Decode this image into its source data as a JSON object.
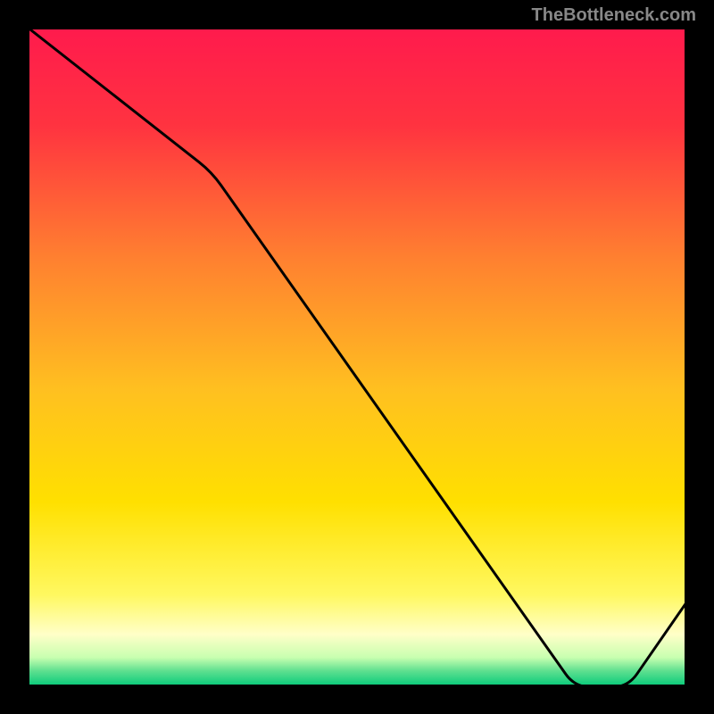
{
  "watermark": "TheBottleneck.com",
  "chart_data": {
    "type": "line",
    "title": "",
    "xlabel": "",
    "ylabel": "",
    "xlim": [
      0,
      100
    ],
    "ylim": [
      0,
      100
    ],
    "x": [
      0,
      28,
      83,
      91,
      100
    ],
    "y": [
      100,
      78,
      0,
      0,
      13
    ],
    "min_label_text": "",
    "background_gradient": {
      "type": "vertical",
      "stops": [
        {
          "offset": 0.0,
          "color": "#ff1a4d"
        },
        {
          "offset": 0.15,
          "color": "#ff3340"
        },
        {
          "offset": 0.35,
          "color": "#ff8030"
        },
        {
          "offset": 0.55,
          "color": "#ffc020"
        },
        {
          "offset": 0.72,
          "color": "#ffe000"
        },
        {
          "offset": 0.86,
          "color": "#fff860"
        },
        {
          "offset": 0.92,
          "color": "#ffffc8"
        },
        {
          "offset": 0.955,
          "color": "#c8ffb0"
        },
        {
          "offset": 0.975,
          "color": "#60e090"
        },
        {
          "offset": 1.0,
          "color": "#00c878"
        }
      ]
    },
    "line_color": "#000000",
    "frame_color": "#000000"
  }
}
